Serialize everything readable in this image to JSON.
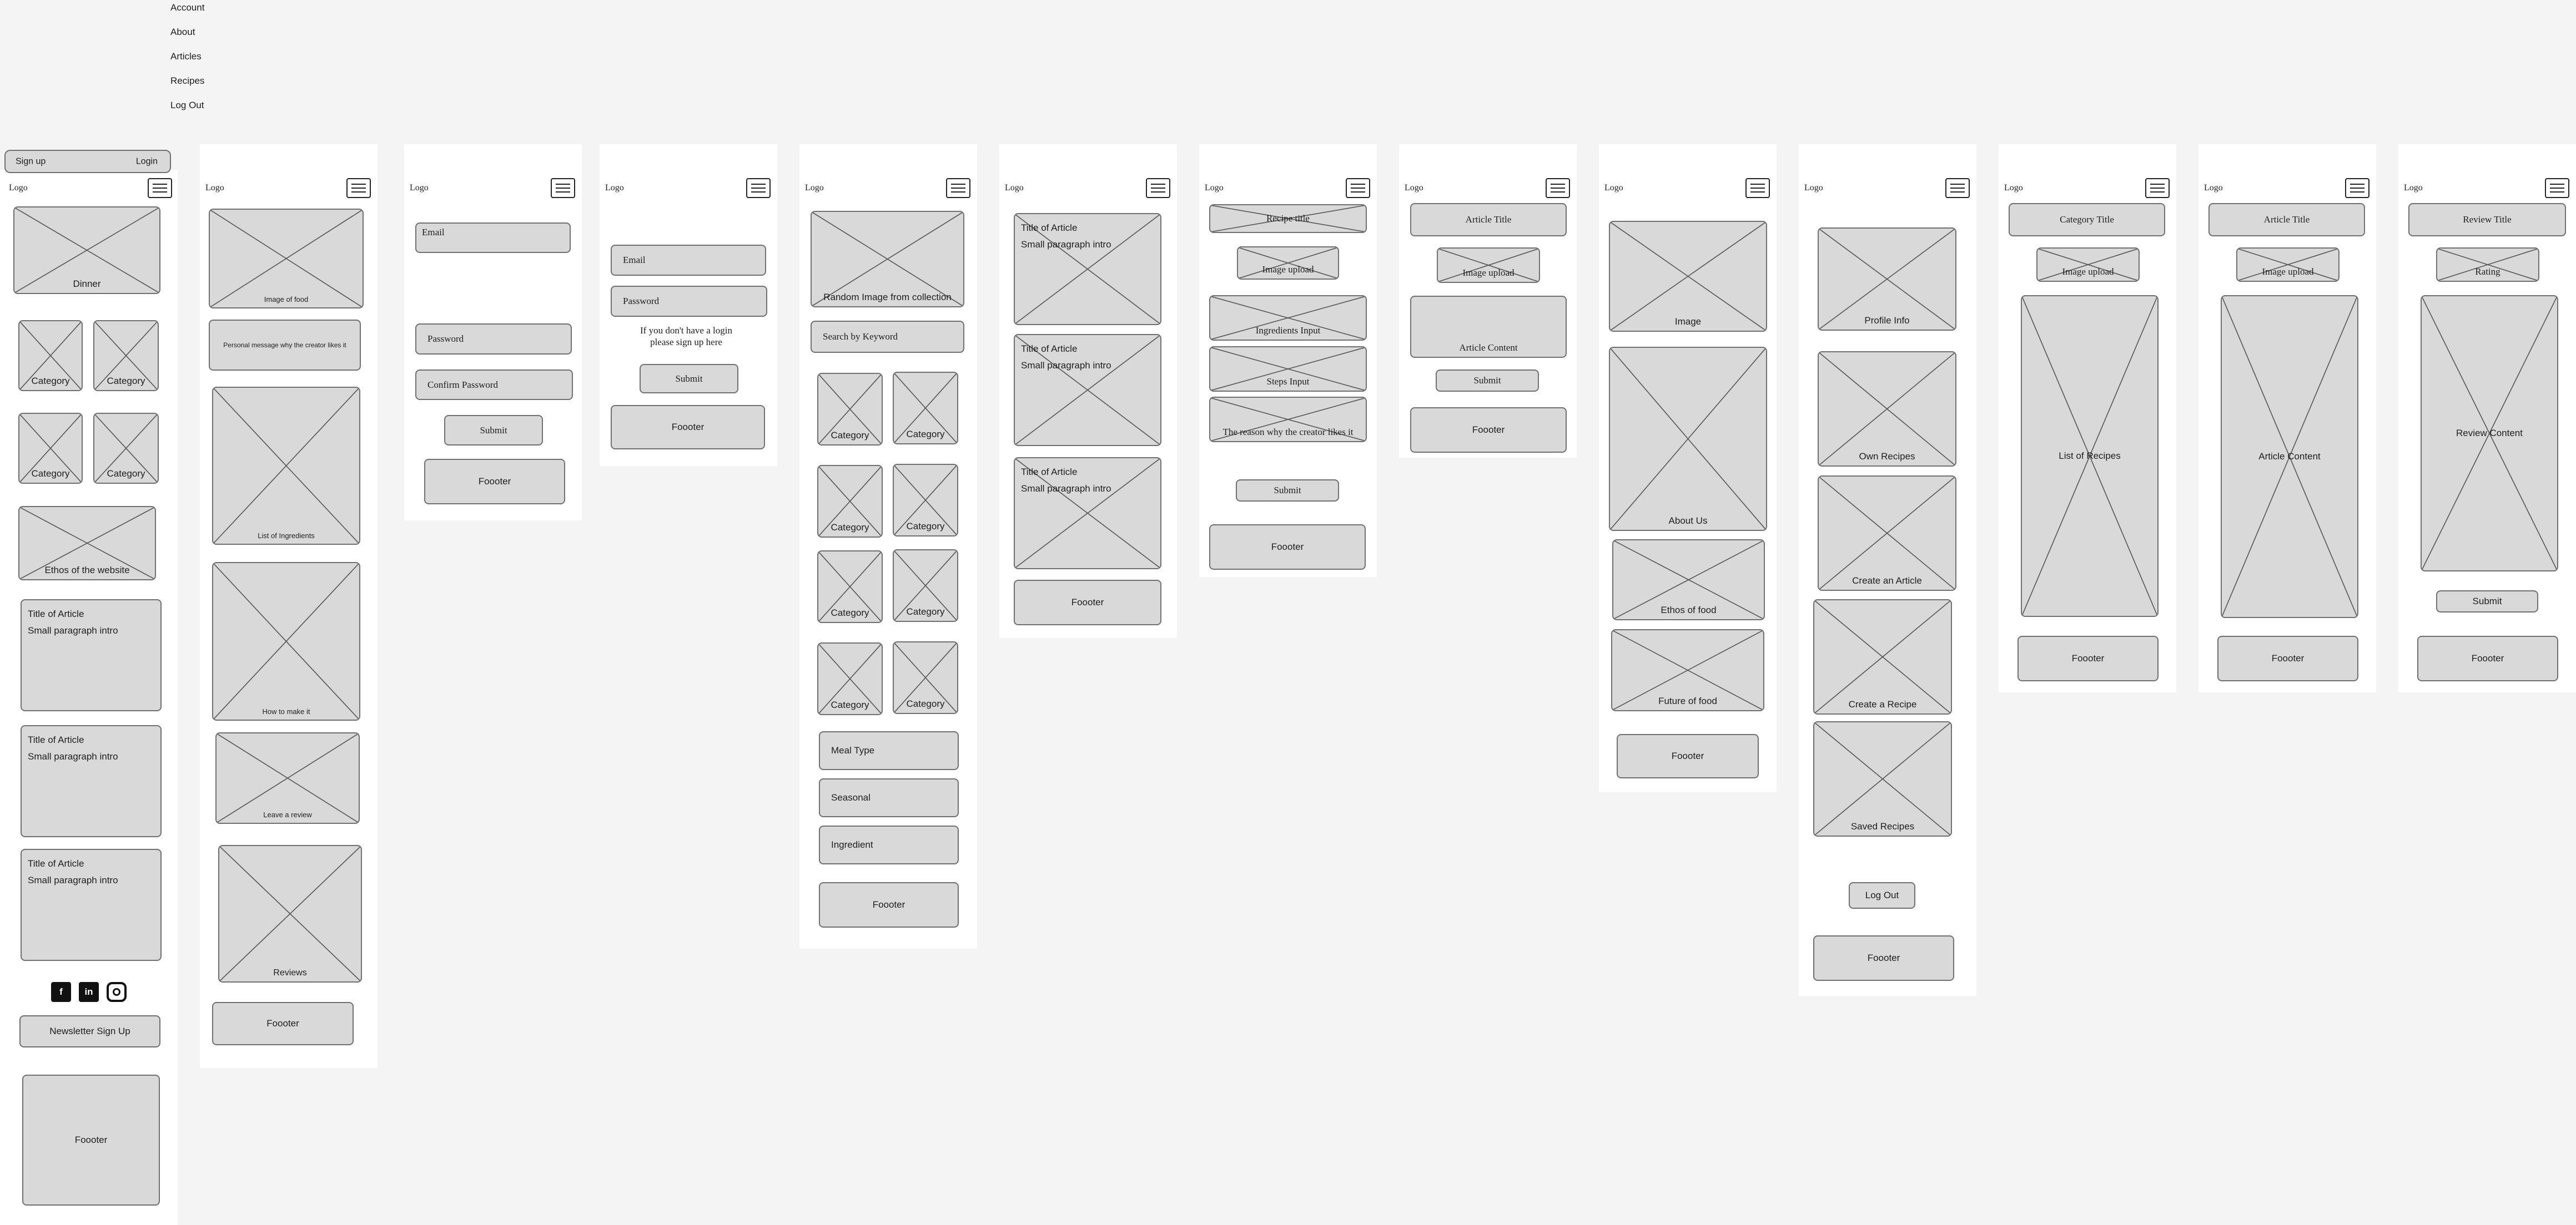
{
  "menu": {
    "items": [
      "Account",
      "About",
      "Articles",
      "Recipes",
      "Log Out"
    ]
  },
  "common": {
    "logo": "Logo",
    "footer": "Foooter",
    "submit": "Submit"
  },
  "home": {
    "signup": "Sign up",
    "login": "Login",
    "hero": "Dinner",
    "categories": [
      "Category",
      "Category",
      "Category",
      "Category"
    ],
    "ethos": "Ethos of the website",
    "articles": [
      {
        "title": "Title of Article",
        "intro": "Small paragraph intro"
      },
      {
        "title": "Title of Article",
        "intro": "Small paragraph intro"
      },
      {
        "title": "Title of Article",
        "intro": "Small paragraph intro"
      }
    ],
    "newsletter": "Newsletter Sign Up"
  },
  "recipe": {
    "image": "Image of food",
    "message": "Personal message why the creator likes it",
    "ingredients": "List of Ingredients",
    "method": "How to make it",
    "review": "Leave a review",
    "reviews": "Reviews"
  },
  "signup_form": {
    "email": "Email",
    "password": "Password",
    "confirm": "Confirm Password"
  },
  "login_form": {
    "email": "Email",
    "password": "Password",
    "hint": "If you don't have a login please sign up here"
  },
  "collection": {
    "random": "Random Image from collection",
    "search": "Search by Keyword",
    "categories": [
      "Category",
      "Category",
      "Category",
      "Category",
      "Category",
      "Category",
      "Category",
      "Category"
    ],
    "filters": [
      "Meal Type",
      "Seasonal",
      "Ingredient"
    ]
  },
  "articles_page": {
    "items": [
      {
        "title": "Title of Article",
        "intro": "Small paragraph intro"
      },
      {
        "title": "Title of Article",
        "intro": "Small paragraph intro"
      },
      {
        "title": "Title of Article",
        "intro": "Small paragraph intro"
      }
    ]
  },
  "create_recipe": {
    "title": "Recipe title",
    "upload": "Image upload",
    "ingredients": "Ingredients Input",
    "steps": "Steps Input",
    "reason": "The reason why the creator likes it"
  },
  "create_article": {
    "title": "Article Title",
    "upload": "Image upload",
    "content": "Article Content"
  },
  "about": {
    "image": "Image",
    "about": "About Us",
    "ethos": "Ethos of food",
    "future": "Future of food"
  },
  "account": {
    "profile": "Profile Info",
    "own": "Own Recipes",
    "create_article": "Create an Article",
    "create_recipe": "Create a Recipe",
    "saved": "Saved Recipes",
    "logout": "Log Out"
  },
  "category_page": {
    "title": "Category Title",
    "upload": "Image upload",
    "list": "List of Recipes"
  },
  "article_page": {
    "title": "Article  Title",
    "upload": "Image upload",
    "content": "Article Content"
  },
  "review_page": {
    "title": "Review  Title",
    "rating": "Rating",
    "content": "Review Content"
  }
}
